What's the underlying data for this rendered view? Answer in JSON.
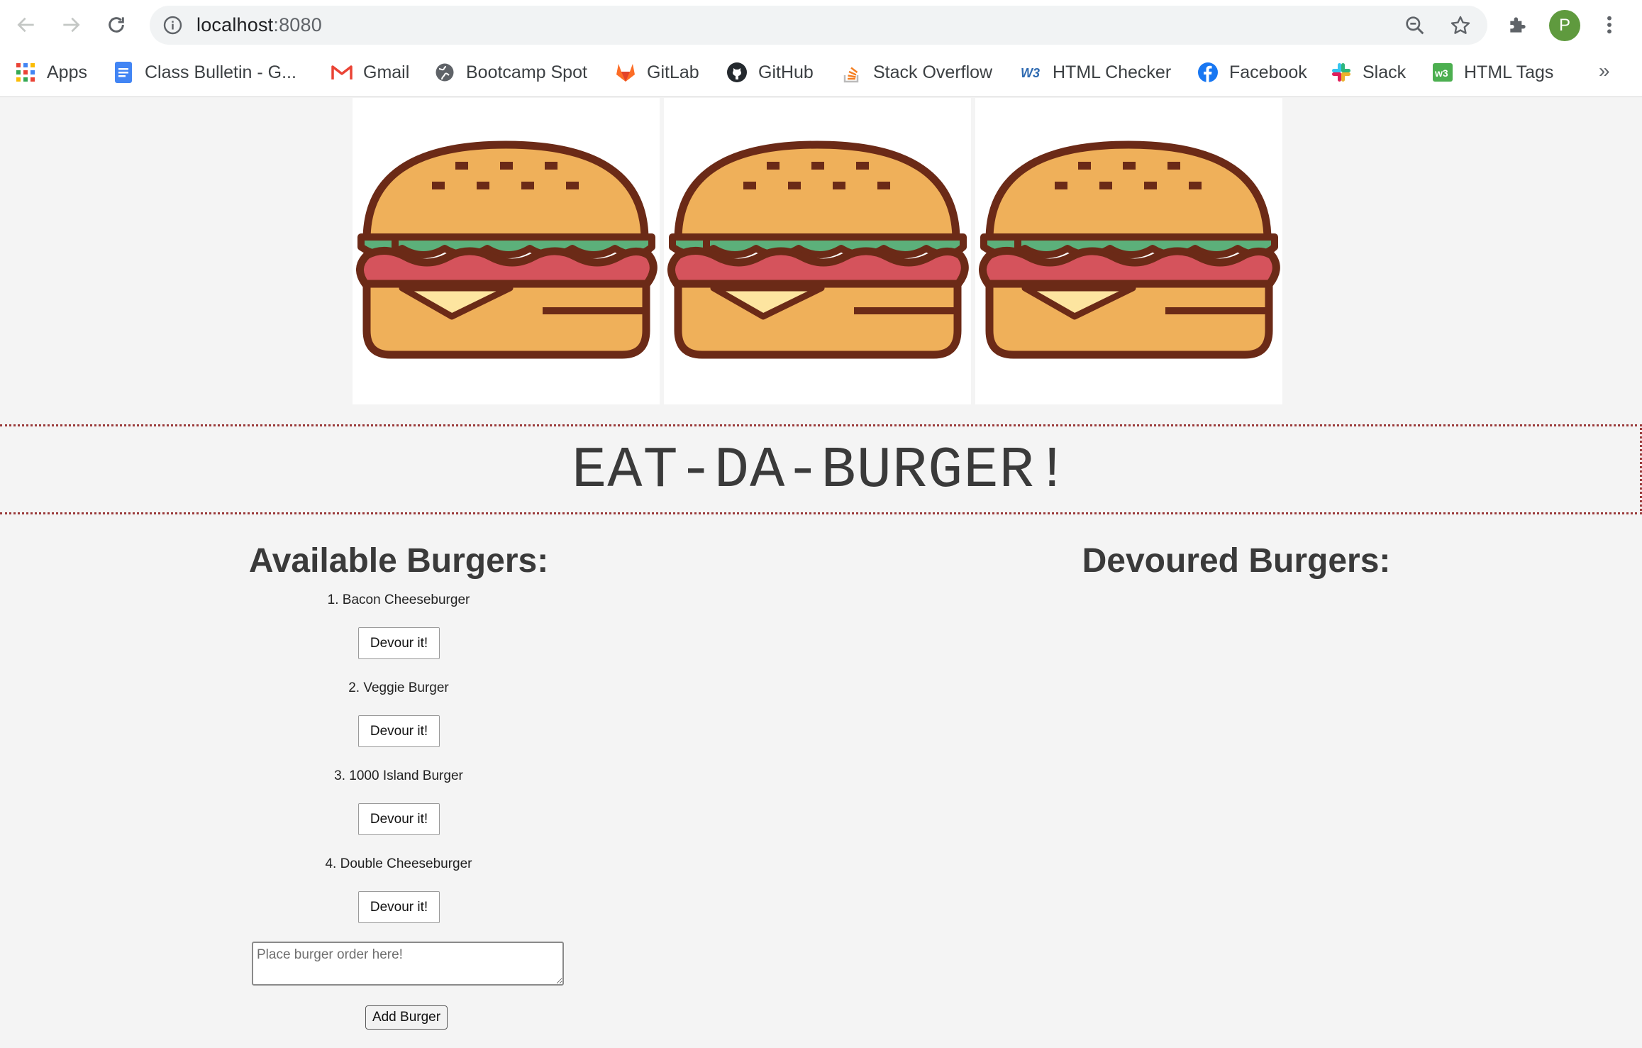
{
  "browser": {
    "url_host": "localhost",
    "url_port": ":8080",
    "profile_initial": "P",
    "bookmarks": [
      {
        "label": "Apps",
        "icon": "apps-grid-icon"
      },
      {
        "label": "Class Bulletin - G...",
        "icon": "google-docs-icon"
      },
      {
        "label": "Gmail",
        "icon": "gmail-icon"
      },
      {
        "label": "Bootcamp Spot",
        "icon": "globe-icon"
      },
      {
        "label": "GitLab",
        "icon": "gitlab-icon"
      },
      {
        "label": "GitHub",
        "icon": "github-icon"
      },
      {
        "label": "Stack Overflow",
        "icon": "stack-overflow-icon"
      },
      {
        "label": "HTML Checker",
        "icon": "w3c-icon"
      },
      {
        "label": "Facebook",
        "icon": "facebook-icon"
      },
      {
        "label": "Slack",
        "icon": "slack-icon"
      },
      {
        "label": "HTML Tags",
        "icon": "w3schools-icon"
      }
    ],
    "more_label": "»"
  },
  "page": {
    "title": "EAT-DA-BURGER!",
    "available_title": "Available Burgers:",
    "devoured_title": "Devoured Burgers:",
    "burgers": [
      {
        "label": "1. Bacon Cheeseburger",
        "button": "Devour it!"
      },
      {
        "label": "2. Veggie Burger",
        "button": "Devour it!"
      },
      {
        "label": "3. 1000 Island Burger",
        "button": "Devour it!"
      },
      {
        "label": "4. Double Cheeseburger",
        "button": "Devour it!"
      }
    ],
    "order_placeholder": "Place burger order here!",
    "add_button": "Add Burger"
  },
  "colors": {
    "bun": "#efb05a",
    "outline": "#6b2a17",
    "lettuce": "#5cb07a",
    "tomato": "#d5535c",
    "cheese": "#fde5a0"
  }
}
